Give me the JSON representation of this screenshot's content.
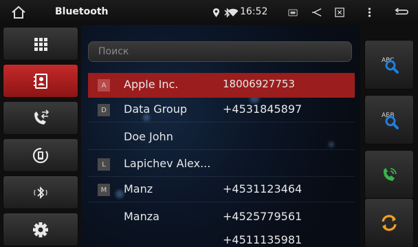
{
  "statusbar": {
    "title": "Bluetooth",
    "time": "16:52",
    "icons": [
      "home-icon",
      "location-icon",
      "bluetooth-status-icon",
      "wifi-icon",
      "screenshot-icon",
      "volume-icon",
      "close-window-icon",
      "more-vert-icon",
      "back-icon"
    ]
  },
  "leftnav": {
    "items": [
      {
        "icon": "dialpad-icon",
        "active": false
      },
      {
        "icon": "contacts-icon",
        "active": true
      },
      {
        "icon": "call-log-icon",
        "active": false
      },
      {
        "icon": "phone-sync-icon",
        "active": false
      },
      {
        "icon": "bluetooth-audio-icon",
        "active": false
      },
      {
        "icon": "settings-icon",
        "active": false
      }
    ]
  },
  "search": {
    "placeholder": "Поиск"
  },
  "contacts": [
    {
      "letter": "A",
      "name": "Apple Inc.",
      "phone": "18006927753",
      "selected": true
    },
    {
      "letter": "D",
      "name": "Data Group",
      "phone": "+4531845897",
      "selected": false
    },
    {
      "letter": "",
      "name": "Doe John",
      "phone": "",
      "selected": false
    },
    {
      "letter": "L",
      "name": "Lapichev Alex...",
      "phone": "",
      "selected": false
    },
    {
      "letter": "M",
      "name": "Manz",
      "phone": "+4531123464",
      "selected": false
    },
    {
      "letter": "",
      "name": "Manza",
      "phone": "+4525779561",
      "selected": false
    },
    {
      "letter": "",
      "name": "",
      "phone": "+4511135981",
      "selected": false
    }
  ],
  "rightpanel": {
    "buttons": [
      {
        "icon": "search-abc-icon",
        "text": "ABC"
      },
      {
        "icon": "search-alphabet-icon",
        "text": "AБВ"
      },
      {
        "icon": "call-icon",
        "text": ""
      },
      {
        "icon": "sync-icon",
        "text": ""
      }
    ]
  },
  "colors": {
    "accent_red": "#9b1d1d",
    "nav_active": "#c42a2a",
    "search_blue": "#1e7fe0",
    "call_green": "#3ab34a",
    "sync_orange": "#f0a020"
  }
}
